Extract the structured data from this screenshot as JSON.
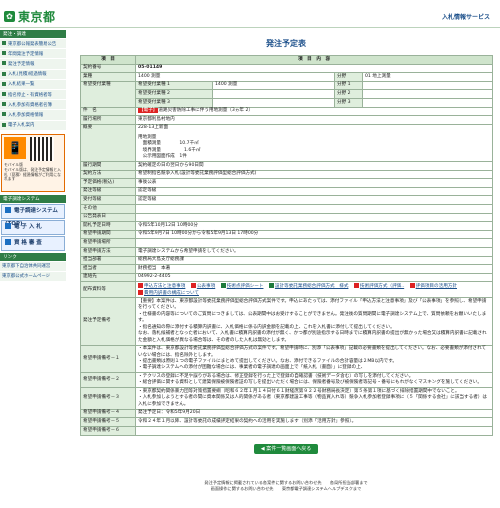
{
  "header": {
    "logo_text": "東京都",
    "service_name": "入札情報サービス"
  },
  "sidebar": {
    "section_title": "発注・調達",
    "links": [
      "東京都公報発表簡易公告",
      "年間発注予定情報",
      "発注予定情報",
      "入札(見積)経過情報",
      "入札結果一覧",
      "指名停止・有資格者等",
      "入札参加有資格者名簿",
      "入札参加資格情報",
      "電子入札案内"
    ],
    "mobile_title": "モバイル版",
    "mobile_text": "モバイル版は、発注予定情報と入札（見積）経過情報がご利用になれます",
    "section2": "電子調達システム",
    "big_buttons": [
      "電子調達システム(TOP)",
      "電 子 入 札",
      "資 格 審 査"
    ],
    "section3": "リンク",
    "extra_links": [
      "東京都下自治体共同運営",
      "東京都公式ホームページ"
    ]
  },
  "main": {
    "title": "発注予定表",
    "col_item": "項　目",
    "col_content": "項　目　内　容",
    "rows": {
      "contract_no_label": "契約番号",
      "contract_no": "05-01149",
      "industry_label": "業種",
      "industry": "1400 測量",
      "category_label": "分野",
      "category": "01 地上測量",
      "hope_label": "希望受付業種",
      "hope1_label": "希望受付業種 1",
      "hope1": "1400 測量",
      "cat1_label": "分野 1",
      "cat1": "",
      "hope2_label": "希望受付業種 2",
      "hope2": "",
      "cat2_label": "分野 2",
      "cat2": "",
      "hope3_label": "希望受付業種 3",
      "hope3": "",
      "cat3_label": "分野 3",
      "cat3": "",
      "name_label": "件　名",
      "name_tag": "【電子】",
      "name": "道路災害防除工事に伴う用地測量（3ヵ年 2）",
      "place_label": "履行場所",
      "place": "東京都利島村地内",
      "place2": "228-13上新面",
      "summary_label": "概要",
      "summary_l1": "用地測量",
      "summary_l2": "　面積測量　　　　10.7千㎡",
      "summary_l3": "　境界測量　　　　　1.6千㎡",
      "summary_l4": "　公示用図面作成　1件",
      "period_label": "履行期間",
      "period": "契約確定の日の翌日から90日間",
      "method_label": "契約方法",
      "method": "希望制指名競争入札(設計等委託業務評価型総合評価方式)",
      "budget_label": "予定価格(税込)",
      "budget": "事後公表",
      "order_label": "発注等級",
      "order": "認定等級",
      "accept_label": "受付等級",
      "accept": "認定等級",
      "other_label": "その他",
      "other": "",
      "notice_date_label": "公告発表日",
      "notice_date": "",
      "open_label": "開札予定日時",
      "open": "令和5年10月12日 10時00分",
      "hope_period_label": "希望申請期間",
      "hope_period": "令和5年9月7日 10時00分から令和5年9月13日 17時00分",
      "hope_place_label": "希望申請場所",
      "hope_place": "",
      "hope_method_label": "希望申請方法",
      "hope_method": "電子調達システムから希望申請をしてください。",
      "dept_label": "担当部署",
      "dept": "総務局大島支庁総務課",
      "person_label": "担当者",
      "person": "財務担当　本著",
      "contact_label": "連絡先",
      "contact": "04992-2-4405",
      "docs_label": "配布資料等",
      "docs": [
        "申込方法と注意事項",
        "公表事項",
        "技術点評価シート",
        "設計等委託業務総合評価方式　様式",
        "技術評価方式（評価..",
        "評価項目の活用方針",
        "費用内訳書の構成について"
      ],
      "pre_label": "発注予定備考",
      "pre_text": "【重要】本案件は、東京都設計等委託業務評価型総合評価方式案件です。申込にあたっては、添付ファイル「申込方法と注意事項」及び「公表事項」を参照し、希望申請を行ってください。\n・仕様書の内容等についてのご質問につきましては、公表期間中はお受けすることができません。発注後の質問期間に電子調達システム上で、質問依頼をお願いいたします。\n・指名通知の際に添付する積算内訳書に、入札価格に係る内訳金額を記載の上、これを入札書に添付して提出してください。\nなお、落札候補者となった者において、入札書に積算内訳書の添付が無く、かつ都が別途指示する日時までに積算内訳書の提出が無かった場合又は積算内訳書に記載された金額と入札価格が異なる場合等は、その者のした入札は無効とします。",
      "note1_label": "希望申請備考－１",
      "note1": "・本案件は、東京都設計等委託業務評価型総合評価方式の案件です。希望申請時に、別添「公表事項」記載の必要書類を提出してください。なお、必要書類が添付されていない場合には、指名除外とします。\n・提出書類は原則１つの電子ファイルにまとめて提出してください。なお、添付できるファイルの合計容量は２MB以内です。\n・電子調達システムへの添付が困難な場合には、事業者の電子調達の画面上で「紙入札（書面）」に登録の上、",
      "note2_label": "希望申請備考－２",
      "note2": "・テクリスの登録に不足や誤りがある場合は、修正登録を行った上で登録の自確認書（技術データ含む）の写しを添付してください。\n・総合評価に関する資料として建築保険被保険者証の写しを提出いただく場合には、保険者番号及び被保険者等記号・番号にもれがなくマスキングを施してください。",
      "note3_label": "希望申請備考－３",
      "note3": "・東京都契約関係暴力団等対策措置要綱（昭和６２年１月１４日付６１財経庶第９２２号財務局長決定）第５条第１項に基づく排除措置期間中でないこと。\n・入札参加しようとする者の間に資本関係又は人的関係がある者（東京都建設工事等（物品買入れ等）競争入札参加者登録事項に（５「関係する会社」に該当する者）は入札に参加できません。",
      "note4_label": "希望申請備考－４",
      "note4": "発注予定日：令和5年9月20日",
      "note5_label": "希望申請備考－５",
      "note5": "令和２４年１月以降、設計等委託の成績評定結果の契約への活用を実施します（別添「活用方針」参照）。",
      "note6_label": "希望申請備考－６",
      "note6": ""
    },
    "back_button": "案件一覧画面へ戻る"
  },
  "footer": {
    "line1": "発注予定情報に掲載されている各案件に関するお問い合わせ先　　各局所担当部署まで",
    "line2": "画面操作に関するお問い合わせ先　　東京都電子調達システムヘルプデスクまで"
  }
}
